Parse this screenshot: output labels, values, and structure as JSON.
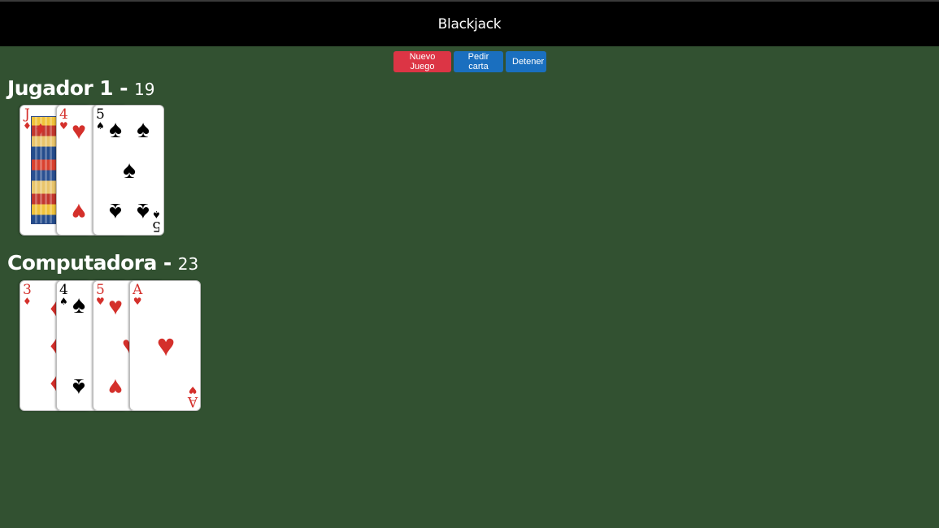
{
  "header": {
    "title": "Blackjack"
  },
  "controls": {
    "new_game": "Nuevo Juego",
    "hit": "Pedir carta",
    "stand": "Detener"
  },
  "colors": {
    "table": "#325131",
    "header": "#000000",
    "danger_button": "#dc3545",
    "primary_button": "#1a6fbf",
    "red_suit": "#d4302b"
  },
  "players": [
    {
      "name": "Jugador 1",
      "separator": "-",
      "score": "19",
      "cards": [
        {
          "rank": "J",
          "suit": "♦",
          "suit_name": "diamonds",
          "color": "red"
        },
        {
          "rank": "4",
          "suit": "♥",
          "suit_name": "hearts",
          "color": "red"
        },
        {
          "rank": "5",
          "suit": "♠",
          "suit_name": "spades",
          "color": "black"
        }
      ]
    },
    {
      "name": "Computadora",
      "separator": "-",
      "score": "23",
      "cards": [
        {
          "rank": "3",
          "suit": "♦",
          "suit_name": "diamonds",
          "color": "red"
        },
        {
          "rank": "4",
          "suit": "♠",
          "suit_name": "spades",
          "color": "black"
        },
        {
          "rank": "5",
          "suit": "♥",
          "suit_name": "hearts",
          "color": "red"
        },
        {
          "rank": "A",
          "suit": "♥",
          "suit_name": "hearts",
          "color": "red"
        }
      ]
    }
  ]
}
